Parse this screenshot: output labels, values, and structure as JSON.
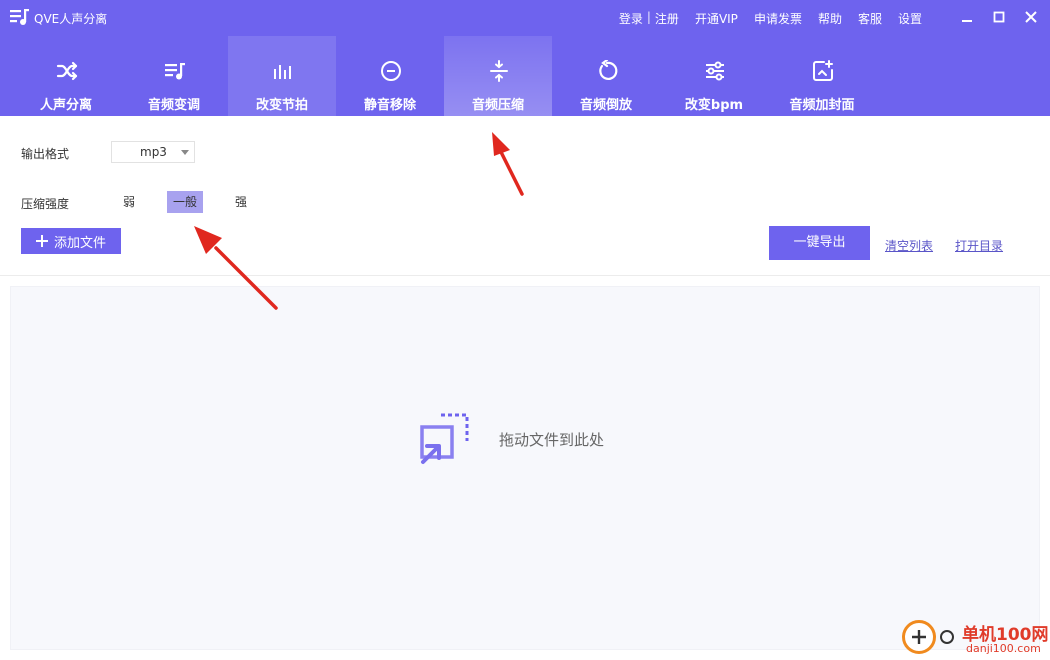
{
  "app": {
    "title": "QVE人声分离"
  },
  "top_menu": {
    "login": "登录",
    "separator": "|",
    "register": "注册",
    "vip": "开通VIP",
    "invoice": "申请发票",
    "help": "帮助",
    "service": "客服",
    "settings": "设置"
  },
  "tabs": [
    {
      "label": "人声分离",
      "icon": "shuffle-icon"
    },
    {
      "label": "音频变调",
      "icon": "music-list-icon"
    },
    {
      "label": "改变节拍",
      "icon": "equalizer-bars-icon"
    },
    {
      "label": "静音移除",
      "icon": "minus-circle-icon"
    },
    {
      "label": "音频压缩",
      "icon": "compress-icon"
    },
    {
      "label": "音频倒放",
      "icon": "rotate-ccw-icon"
    },
    {
      "label": "改变bpm",
      "icon": "sliders-icon"
    },
    {
      "label": "音频加封面",
      "icon": "image-add-icon"
    }
  ],
  "active_tab": "音频压缩",
  "options": {
    "format_label": "输出格式",
    "format_value": "mp3",
    "strength_label": "压缩强度",
    "strength_options": [
      "弱",
      "一般",
      "强"
    ],
    "strength_selected": "一般"
  },
  "actions": {
    "add_file": "添加文件",
    "export": "一键导出",
    "clear_list": "清空列表",
    "open_dir": "打开目录"
  },
  "drop_zone": {
    "text": "拖动文件到此处"
  },
  "watermark": {
    "cn": "单机100网",
    "en": "danji100.com"
  },
  "colors": {
    "brand": "#6e63ee",
    "selected": "#a8a2ef",
    "arrow": "#e0281f"
  }
}
